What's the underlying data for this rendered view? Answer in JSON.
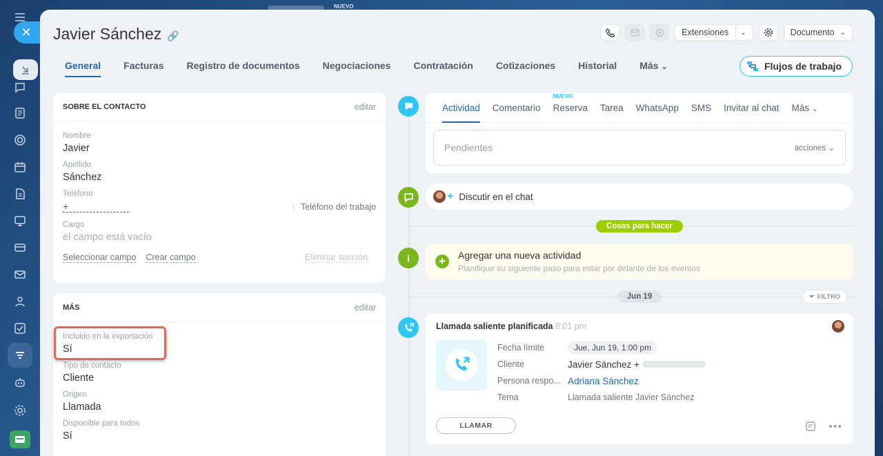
{
  "background": {
    "nuevo_badge": "NUEVO"
  },
  "header": {
    "title": "Javier Sánchez",
    "extensions_label": "Extensiones",
    "document_label": "Documento"
  },
  "tabs": [
    {
      "label": "General",
      "active": true
    },
    {
      "label": "Facturas"
    },
    {
      "label": "Registro de documentos"
    },
    {
      "label": "Negociaciones"
    },
    {
      "label": "Contratación"
    },
    {
      "label": "Cotizaciones"
    },
    {
      "label": "Historial"
    },
    {
      "label": "Más"
    }
  ],
  "workflows_button": "Flujos de trabajo",
  "about": {
    "header": "SOBRE EL CONTACTO",
    "edit": "editar",
    "name_label": "Nombre",
    "name": "Javier",
    "lastname_label": "Apellido",
    "lastname": "Sánchez",
    "phone_label": "Teléfono",
    "phone": "+",
    "phone_type": "Teléfono del trabajo",
    "position_label": "Cargo",
    "position": "el campo está vacío",
    "select_field": "Seleccionar campo",
    "create_field": "Crear campo",
    "delete_section": "Eliminar sección"
  },
  "more": {
    "header": "MÁS",
    "edit": "editar",
    "export_label": "Incluido en la exportación",
    "export_value": "Sí",
    "type_label": "Tipo de contacto",
    "type_value": "Cliente",
    "origin_label": "Origen",
    "origin_value": "Llamada",
    "available_label": "Disponible para todos",
    "available_value": "Sí"
  },
  "activity": {
    "tabs": [
      "Actividad",
      "Comentario",
      "Reserva",
      "Tarea",
      "WhatsApp",
      "SMS",
      "Invitar al chat",
      "Más"
    ],
    "new_badge": "NUEVO",
    "pending_placeholder": "Pendientes",
    "actions": "acciones"
  },
  "chat": {
    "label": "Discutir en el chat"
  },
  "todo_chip": "Cosas para hacer",
  "add_activity": {
    "title": "Agregar una nueva actividad",
    "subtitle": "Planifique su siguiente paso para estar por delante de los eventos"
  },
  "date_chip": "Jun 19",
  "filter": "FILTRO",
  "call": {
    "title": "Llamada saliente planificada",
    "time": "8:01 pm",
    "deadline_label": "Fecha límite",
    "deadline": "Jue, Jun 19, 1:00 pm",
    "client_label": "Cliente",
    "client": "Javier Sánchez +",
    "responsible_label": "Persona respo...",
    "responsible": "Adriana Sánchez",
    "subject_label": "Tema",
    "subject": "Llamada saliente Javier Sánchez",
    "call_button": "LLAMAR"
  },
  "colors": {
    "accent": "#2067b0",
    "cyan": "#2fc6f6",
    "green": "#9dcf00",
    "timeline_green": "#7bb61f",
    "highlight": "#e0675c"
  }
}
